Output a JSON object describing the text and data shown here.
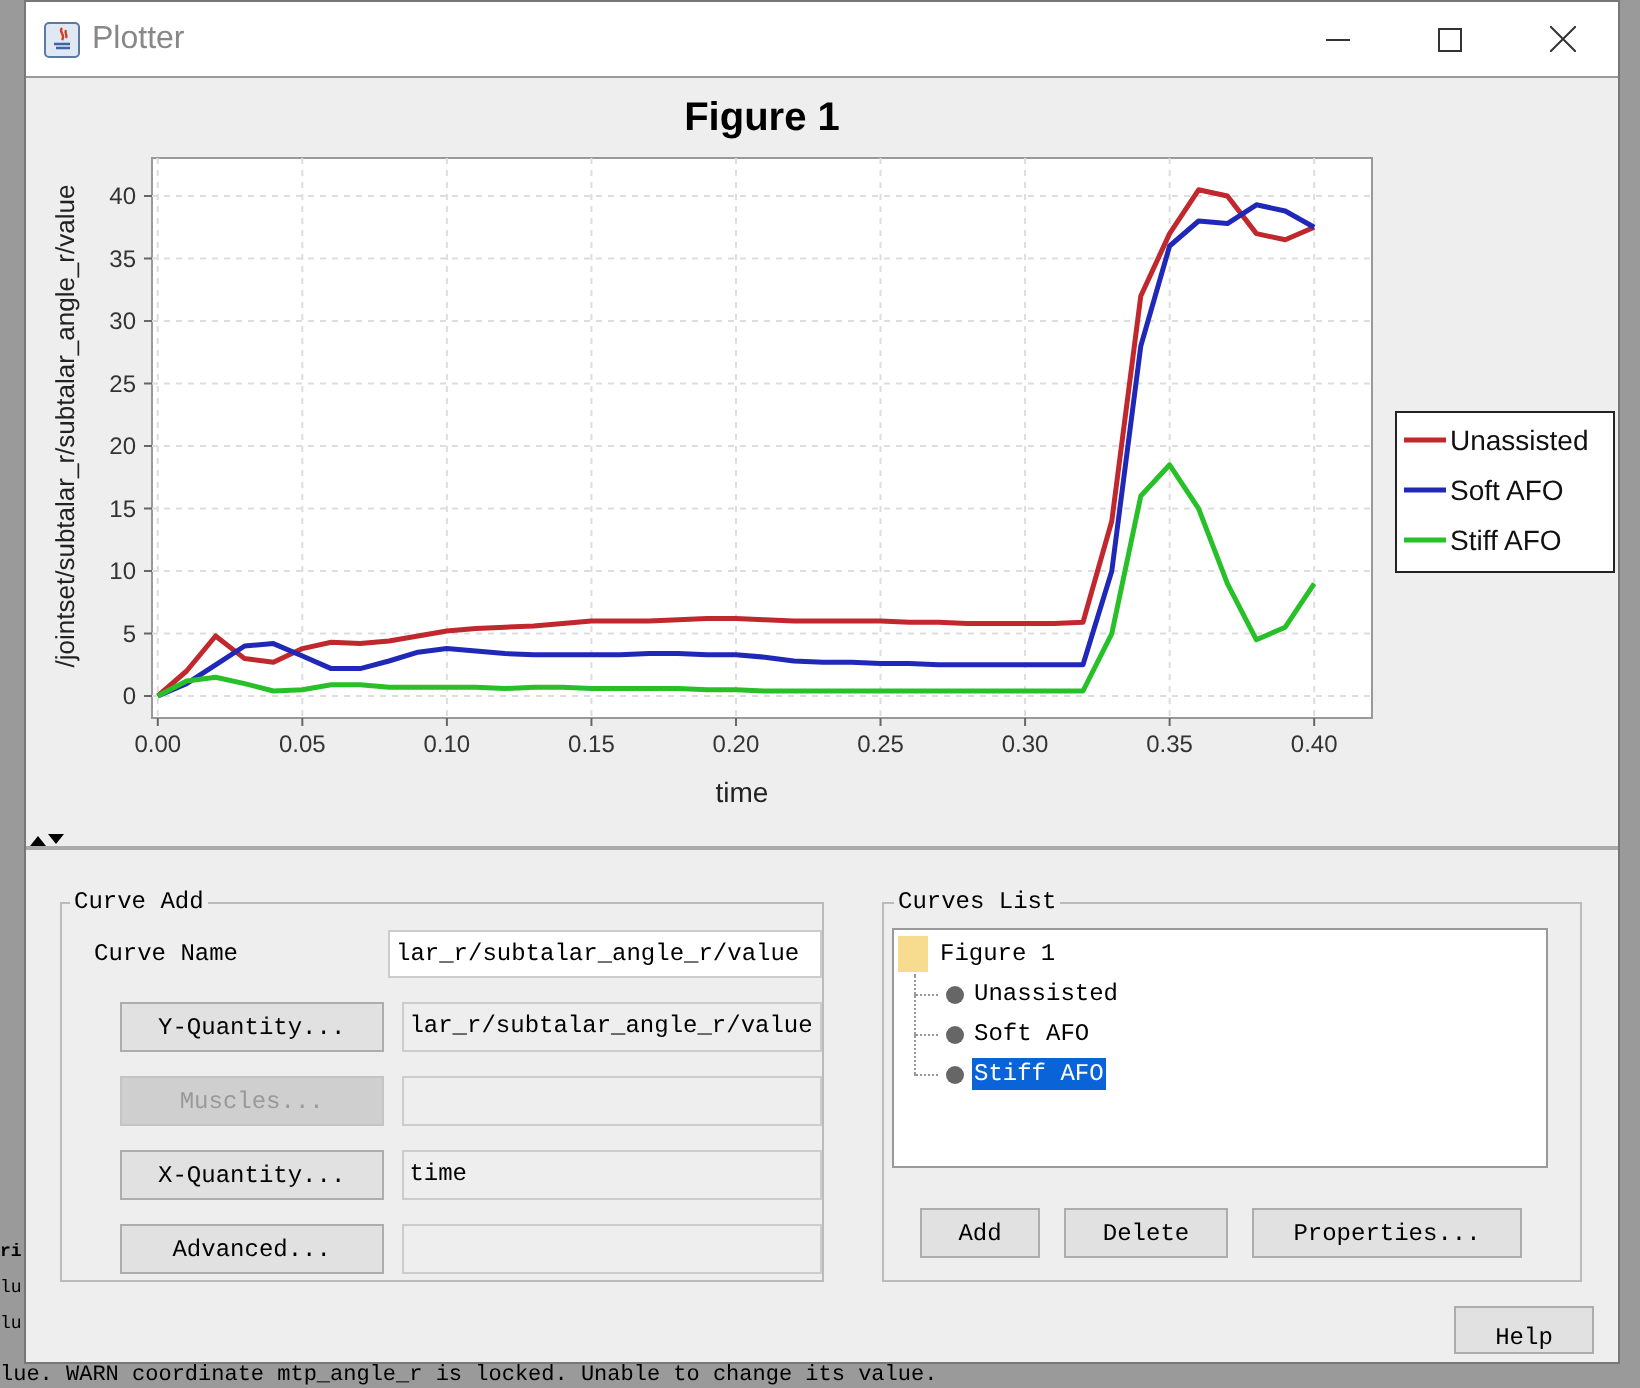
{
  "window": {
    "title": "Plotter"
  },
  "plot": {
    "chart_data": {
      "type": "line",
      "title": "Figure 1",
      "xlabel": "time",
      "ylabel": "/jointset/subtalar_r/subtalar_angle_r/value",
      "x": [
        0,
        0.01,
        0.02,
        0.03,
        0.04,
        0.05,
        0.06,
        0.07,
        0.08,
        0.09,
        0.1,
        0.11,
        0.12,
        0.13,
        0.14,
        0.15,
        0.16,
        0.17,
        0.18,
        0.19,
        0.2,
        0.21,
        0.22,
        0.23,
        0.24,
        0.25,
        0.26,
        0.27,
        0.28,
        0.29,
        0.3,
        0.31,
        0.32,
        0.33,
        0.34,
        0.35,
        0.36,
        0.37,
        0.38,
        0.39,
        0.4
      ],
      "series": [
        {
          "name": "Unassisted",
          "color": "#c0282d",
          "values": [
            0,
            2,
            4.8,
            3,
            2.7,
            3.8,
            4.3,
            4.2,
            4.4,
            4.8,
            5.2,
            5.4,
            5.5,
            5.6,
            5.8,
            6,
            6,
            6,
            6.1,
            6.2,
            6.2,
            6.1,
            6,
            6,
            6,
            6,
            5.9,
            5.9,
            5.8,
            5.8,
            5.8,
            5.8,
            5.9,
            14,
            32,
            37,
            40.5,
            40,
            37,
            36.5,
            37.5
          ]
        },
        {
          "name": "Soft AFO",
          "color": "#2028b8",
          "values": [
            0,
            1,
            2.5,
            4,
            4.2,
            3.2,
            2.2,
            2.2,
            2.8,
            3.5,
            3.8,
            3.6,
            3.4,
            3.3,
            3.3,
            3.3,
            3.3,
            3.4,
            3.4,
            3.3,
            3.3,
            3.1,
            2.8,
            2.7,
            2.7,
            2.6,
            2.6,
            2.5,
            2.5,
            2.5,
            2.5,
            2.5,
            2.5,
            10,
            28,
            36,
            38,
            37.8,
            39.3,
            38.8,
            37.5
          ]
        },
        {
          "name": "Stiff AFO",
          "color": "#28c028",
          "values": [
            0,
            1.2,
            1.5,
            1,
            0.4,
            0.5,
            0.9,
            0.9,
            0.7,
            0.7,
            0.7,
            0.7,
            0.6,
            0.7,
            0.7,
            0.6,
            0.6,
            0.6,
            0.6,
            0.5,
            0.5,
            0.4,
            0.4,
            0.4,
            0.4,
            0.4,
            0.4,
            0.4,
            0.4,
            0.4,
            0.4,
            0.4,
            0.4,
            5,
            16,
            18.5,
            15,
            9,
            4.5,
            5.5,
            9
          ]
        }
      ],
      "xlim": [
        -0.002,
        0.42
      ],
      "ylim": [
        -1.76,
        43.04
      ],
      "grid": true,
      "legend": true,
      "xticks": [
        {
          "value": 0,
          "label": "0.00"
        },
        {
          "value": 0.05,
          "label": "0.05"
        },
        {
          "value": 0.1,
          "label": "0.10"
        },
        {
          "value": 0.15,
          "label": "0.15"
        },
        {
          "value": 0.2,
          "label": "0.20"
        },
        {
          "value": 0.25,
          "label": "0.25"
        },
        {
          "value": 0.3,
          "label": "0.30"
        },
        {
          "value": 0.35,
          "label": "0.35"
        },
        {
          "value": 0.4,
          "label": "0.40"
        }
      ],
      "yticks": [
        0,
        5,
        10,
        15,
        20,
        25,
        30,
        35,
        40
      ]
    }
  },
  "curve_add": {
    "title": "Curve Add",
    "curve_name_label": "Curve Name",
    "curve_name": "lar_r/subtalar_angle_r/value",
    "rows": [
      {
        "button": "Y-Quantity...",
        "disabled": false,
        "value": "lar_r/subtalar_angle_r/value"
      },
      {
        "button": "Muscles...",
        "disabled": true
      },
      {
        "button": "X-Quantity...",
        "disabled": false,
        "value": "time"
      },
      {
        "button": "Advanced...",
        "disabled": false
      }
    ]
  },
  "curves_list": {
    "title": "Curves List",
    "tree": {
      "label": "Figure 1",
      "expanded": true,
      "children": [
        {
          "label": "Unassisted",
          "selected": false
        },
        {
          "label": "Soft AFO",
          "selected": false
        },
        {
          "label": "Stiff AFO",
          "selected": true
        }
      ]
    },
    "buttons": [
      "Add",
      "Delete",
      "Properties..."
    ]
  },
  "help_button": "Help",
  "background_console": {
    "side_fragments": [
      "ri",
      "lu",
      "lu"
    ],
    "bottom_line": "lue. WARN  coordinate mtp_angle_r is locked. Unable to change its value."
  }
}
